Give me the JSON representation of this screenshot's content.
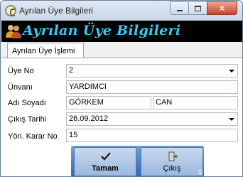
{
  "window": {
    "title": "Ayrılan Üye Bilgileri"
  },
  "banner": {
    "title": "Ayrılan Üye Bilgileri"
  },
  "tabs": [
    {
      "label": "Ayrılan Üye İşlemi"
    }
  ],
  "form": {
    "member_no": {
      "label": "Üye No",
      "value": "2"
    },
    "title": {
      "label": "Ünvanı",
      "value": "YARDIMCI"
    },
    "name": {
      "label": "Adı Soyadı",
      "first": "GÖRKEM",
      "last": "CAN"
    },
    "exit_date": {
      "label": "Çıkış Tarihi",
      "value": "26.09.2012"
    },
    "board_decision_no": {
      "label": "Yön. Karar No",
      "value": "15"
    }
  },
  "toolbar": {
    "ok_label": "Tamam",
    "exit_label": "Çıkış"
  },
  "colors": {
    "banner_bg": "#000000",
    "banner_text": "#3ec8f0",
    "toolbar_blue": "#2f67b0"
  }
}
